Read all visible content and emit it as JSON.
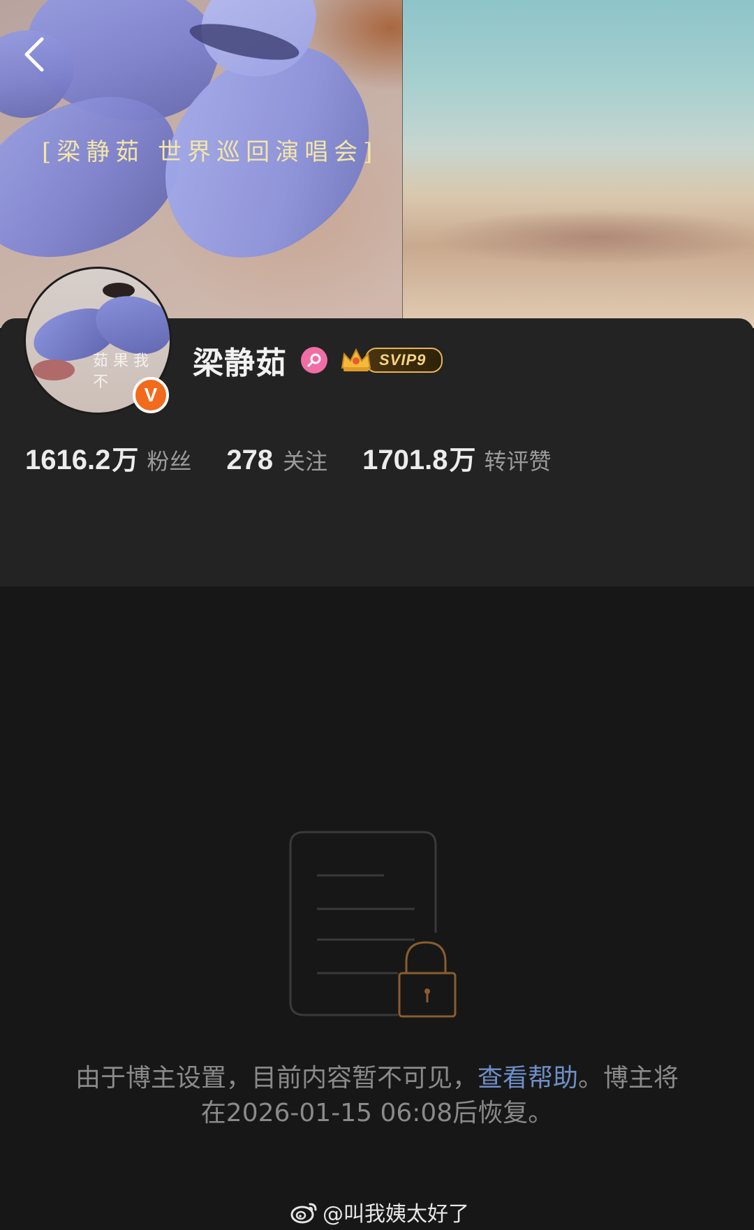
{
  "cover": {
    "title_text": "[梁静茹 世界巡回演唱会]"
  },
  "nav": {
    "back_icon": "chevron-left-icon"
  },
  "profile": {
    "name": "梁静茹",
    "gender_icon": "female-icon",
    "gender_color": "#f06ea5",
    "vip_label": "SVIP9",
    "verified_icon": "verified-v-icon",
    "verified_color": "#f26a1b",
    "avatar_text": "茹 果 我 不",
    "stats": [
      {
        "number": "1616.2",
        "unit": "万",
        "label": "粉丝"
      },
      {
        "number": "278",
        "unit": "",
        "label": "关注"
      },
      {
        "number": "1701.8",
        "unit": "万",
        "label": "转评赞"
      }
    ]
  },
  "locked": {
    "illustration_icon": "locked-document-icon",
    "message_part1": "由于博主设置，目前内容暂不可见，",
    "help_link": "查看帮助",
    "message_part2": "。博主将在2026-01-15 06:08后恢复。",
    "link_color": "#6e8fc7"
  },
  "watermark": {
    "icon": "weibo-icon",
    "text": "@叫我姨太好了"
  }
}
